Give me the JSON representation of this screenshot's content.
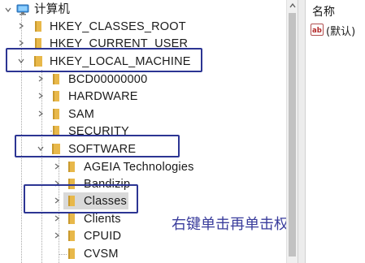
{
  "tree": {
    "root": {
      "label": "计算机",
      "icon": "computer-icon"
    },
    "nodes": [
      {
        "id": "classes_root",
        "label": "HKEY_CLASSES_ROOT",
        "level": 1,
        "state": "collapsed"
      },
      {
        "id": "current_user",
        "label": "HKEY_CURRENT_USER",
        "level": 1,
        "state": "collapsed"
      },
      {
        "id": "local_machine",
        "label": "HKEY_LOCAL_MACHINE",
        "level": 1,
        "state": "expanded"
      },
      {
        "id": "bcd",
        "label": "BCD00000000",
        "level": 2,
        "state": "collapsed"
      },
      {
        "id": "hardware",
        "label": "HARDWARE",
        "level": 2,
        "state": "collapsed"
      },
      {
        "id": "sam",
        "label": "SAM",
        "level": 2,
        "state": "collapsed"
      },
      {
        "id": "security",
        "label": "SECURITY",
        "level": 2,
        "state": "leaf"
      },
      {
        "id": "software",
        "label": "SOFTWARE",
        "level": 2,
        "state": "expanded"
      },
      {
        "id": "ageia",
        "label": "AGEIA Technologies",
        "level": 3,
        "state": "collapsed"
      },
      {
        "id": "bandizip",
        "label": "Bandizip",
        "level": 3,
        "state": "collapsed"
      },
      {
        "id": "classes",
        "label": "Classes",
        "level": 3,
        "state": "collapsed",
        "selected": true
      },
      {
        "id": "clients",
        "label": "Clients",
        "level": 3,
        "state": "collapsed"
      },
      {
        "id": "cpuid",
        "label": "CPUID",
        "level": 3,
        "state": "collapsed"
      },
      {
        "id": "cvsm",
        "label": "CVSM",
        "level": 3,
        "state": "leaf"
      }
    ]
  },
  "list": {
    "column_name": "名称",
    "values": [
      {
        "name": "(默认)",
        "icon": "string-value-icon"
      }
    ]
  },
  "annotation": {
    "text": "右键单击再单击权限",
    "color": "#2c3593"
  },
  "colors": {
    "folder": "#e8b84a",
    "selected_bg": "#d9d9d9",
    "chevron": "#6e6e6e"
  }
}
